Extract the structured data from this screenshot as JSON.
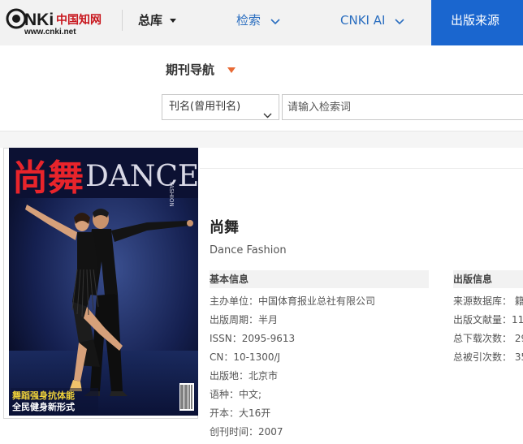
{
  "header": {
    "logo_text": "CNKi中国知网",
    "logo_url_text": "www.cnki.net",
    "nav": {
      "zongku": "总库",
      "jiansuo": "检索",
      "cnki_ai": "CNKI AI",
      "chuban": "出版来源"
    }
  },
  "search": {
    "journal_nav_label": "期刊导航",
    "field_select": "刊名(曾用刊名)",
    "input_placeholder": "请输入检索词"
  },
  "journal": {
    "title": "尚舞",
    "subtitle": "Dance Fashion",
    "cover": {
      "title_cn": "尚舞",
      "title_en": "DANCE",
      "title_en_small": "FASHION",
      "cover_line_1": "舞蹈强身抗体能",
      "cover_line_2": "全民健身新形式"
    },
    "basic_info": {
      "heading": "基本信息",
      "items": [
        "主办单位：中国体育报业总社有限公司",
        "出版周期：半月",
        "ISSN：2095-9613",
        "CN：10-1300/J",
        "出版地：北京市",
        "语种：中文;",
        "开本：大16开",
        "创刊时间：2007"
      ]
    },
    "publish_info": {
      "heading": "出版信息",
      "items": [
        "来源数据库：  籍",
        "出版文献量：11",
        "总下载次数：  29",
        "总被引次数：  35"
      ]
    }
  },
  "colors": {
    "nav_bg": "#f2f2f2",
    "nav_link": "#2c6fc0",
    "active_tab": "#1a66cf",
    "nav_triangle": "#e86a35"
  }
}
